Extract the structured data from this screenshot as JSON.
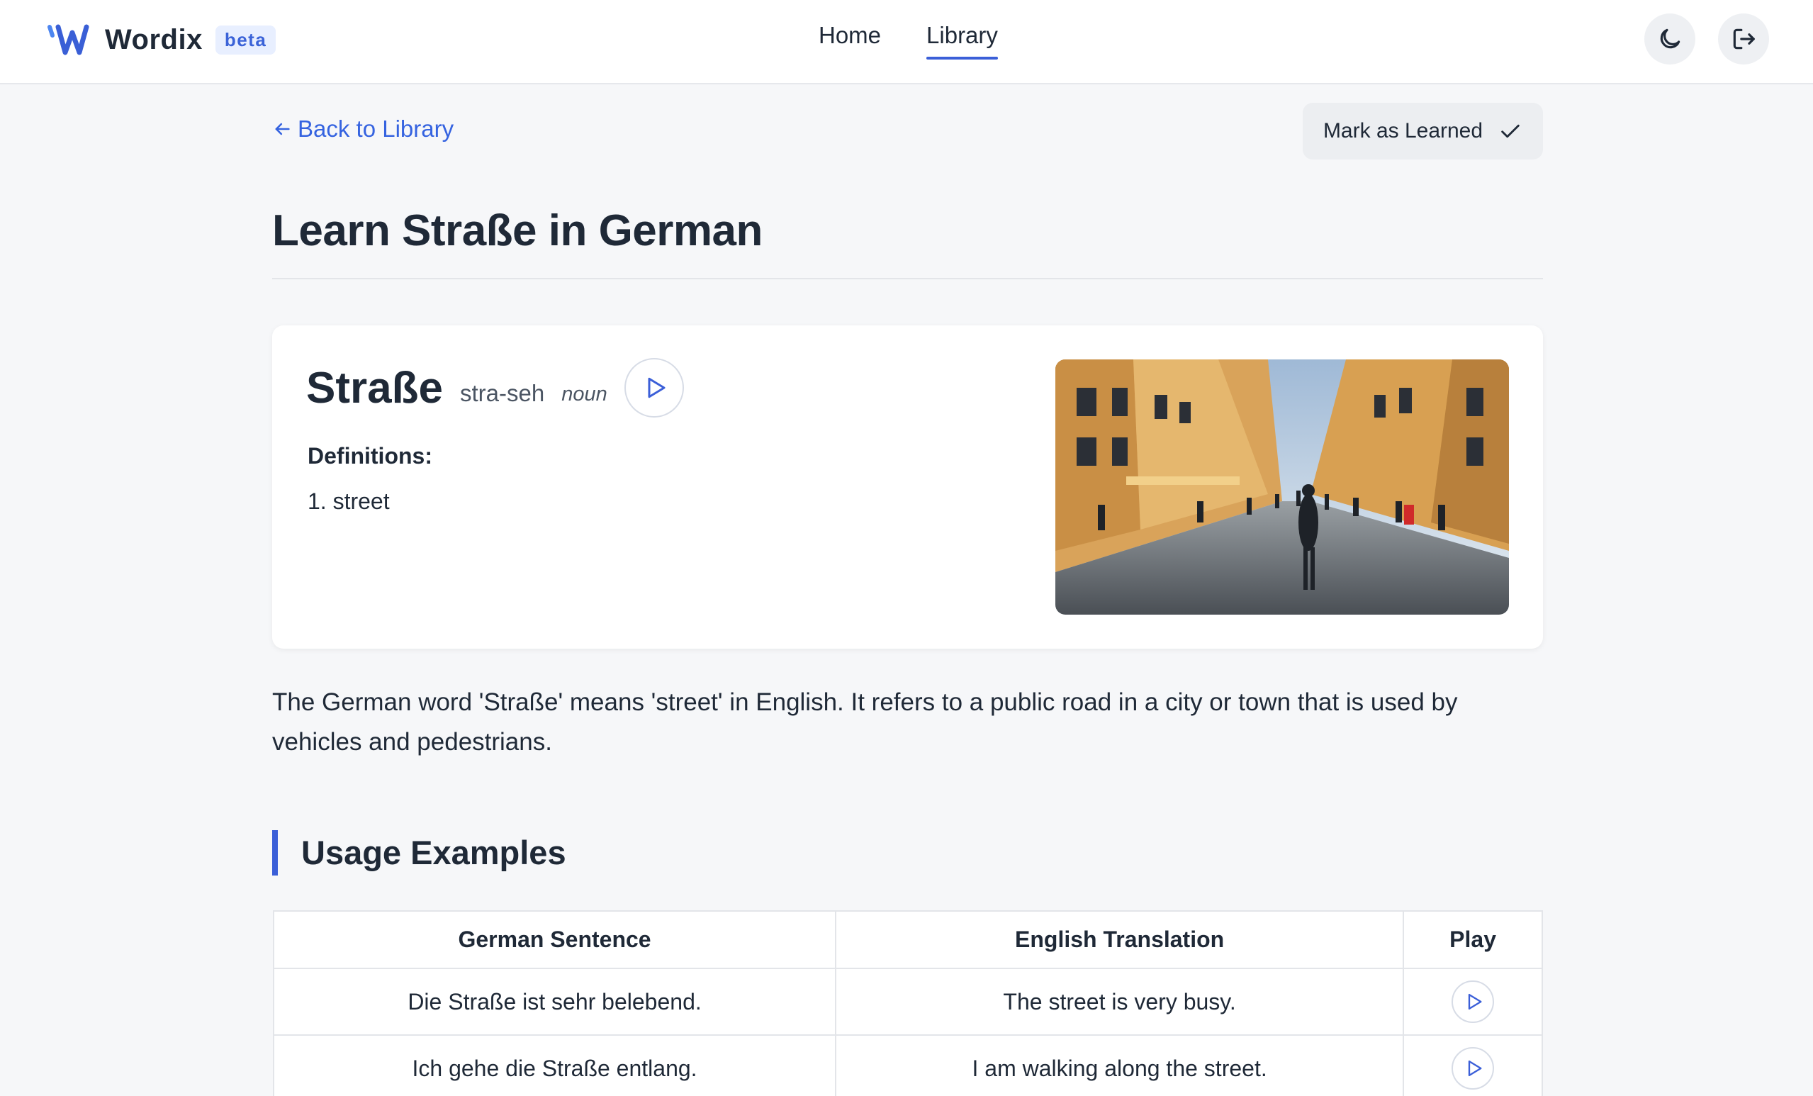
{
  "header": {
    "logo_text": "Wordix",
    "badge": "beta",
    "nav": [
      {
        "label": "Home",
        "active": false
      },
      {
        "label": "Library",
        "active": true
      }
    ],
    "icons": {
      "theme": "moon-icon",
      "logout": "logout-icon"
    }
  },
  "toolbar": {
    "back_label": "Back to Library",
    "mark_learned_label": "Mark as Learned"
  },
  "page": {
    "title": "Learn Straße in German"
  },
  "word": {
    "term": "Straße",
    "pronunciation": "stra-seh",
    "part_of_speech": "noun",
    "definitions_heading": "Definitions:",
    "definitions": [
      "1. street"
    ],
    "image_alt": "City street with pedestrians"
  },
  "description": "The German word 'Straße' means 'street' in English. It refers to a public road in a city or town that is used by vehicles and pedestrians.",
  "usage": {
    "heading": "Usage Examples",
    "columns": [
      "German Sentence",
      "English Translation",
      "Play"
    ],
    "rows": [
      {
        "german": "Die Straße ist sehr belebend.",
        "english": "The street is very busy."
      },
      {
        "german": "Ich gehe die Straße entlang.",
        "english": "I am walking along the street."
      }
    ]
  },
  "colors": {
    "accent": "#3b5fd8",
    "link": "#3563e0",
    "background": "#f6f7f9"
  }
}
